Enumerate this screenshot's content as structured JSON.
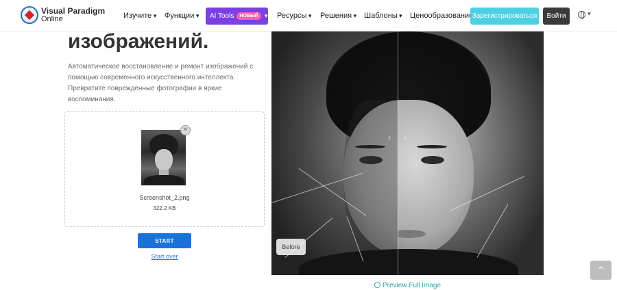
{
  "brand": {
    "line1": "Visual Paradigm",
    "line2": "Online"
  },
  "nav": {
    "items": [
      {
        "label": "Изучите"
      },
      {
        "label": "Функции"
      },
      {
        "label": "Ресурсы"
      },
      {
        "label": "Решения"
      },
      {
        "label": "Шаблоны"
      },
      {
        "label": "Ценообразование"
      }
    ],
    "ai_tools": {
      "label": "AI Tools",
      "badge": "НОВЫЙ"
    },
    "register_label": "Зарегистрироваться",
    "login_label": "Войти",
    "language_icon": "globe-icon"
  },
  "hero": {
    "heading": "изображений.",
    "description": "Автоматическое восстановление и ремонт изображений с помощью современного искусственного интеллекта. Превратите поврежденные фотографии в яркие воспоминания."
  },
  "upload": {
    "file_name": "Screenshot_2.png",
    "file_size": "322.2 KB",
    "start_label": "START",
    "start_over_label": "Start over"
  },
  "comparison": {
    "before_label": "Before",
    "preview_label": "Preview Full Image"
  },
  "colors": {
    "ai_purple": "#7b3fe4",
    "register_cyan": "#4dd0e1",
    "start_blue": "#1a73d9",
    "preview_teal": "#2aa7a0"
  }
}
